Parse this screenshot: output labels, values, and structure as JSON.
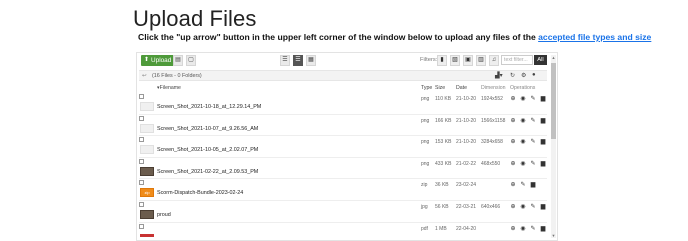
{
  "page": {
    "title": "Upload Files",
    "instructions": "Click the \"up arrow\" button in the upper left corner of the window below to upload any files of the",
    "link_text": "accepted file types and size"
  },
  "toolbar": {
    "upload_label": "Upload",
    "filters_label": "Filters:",
    "text_filter_placeholder": "text filter...",
    "all_label": "All"
  },
  "path": {
    "summary": "(16 Files - 0 Folders)"
  },
  "columns": {
    "filename": "▾Filename",
    "type": "Type",
    "size": "Size",
    "date": "Date",
    "dimension": "Dimension",
    "operations": "Operations"
  },
  "files": [
    {
      "name": "Screen_Shot_2021-10-18_at_12.29.14_PM",
      "type": "png",
      "size": "110 KB",
      "date": "21-10-20",
      "dimension": "1924x552",
      "thumb": "screenshot"
    },
    {
      "name": "Screen_Shot_2021-10-07_at_9.26.56_AM",
      "type": "png",
      "size": "166 KB",
      "date": "21-10-20",
      "dimension": "1566x1158",
      "thumb": "screenshot"
    },
    {
      "name": "Screen_Shot_2021-10-05_at_2.02.07_PM",
      "type": "png",
      "size": "153 KB",
      "date": "21-10-20",
      "dimension": "3284x658",
      "thumb": "screenshot"
    },
    {
      "name": "Screen_Shot_2021-02-22_at_2.09.53_PM",
      "type": "png",
      "size": "433 KB",
      "date": "21-02-22",
      "dimension": "468x550",
      "thumb": "photo"
    },
    {
      "name": "Scorm-Dispatch-Bundle-2023-02-24",
      "type": "zip",
      "size": "36 KB",
      "date": "23-02-24",
      "dimension": "",
      "thumb": "zip"
    },
    {
      "name": "proud",
      "type": "jpg",
      "size": "56 KB",
      "date": "22-03-21",
      "dimension": "640x466",
      "thumb": "photo"
    },
    {
      "name": "",
      "type": "pdf",
      "size": "1 MB",
      "date": "22-04-20",
      "dimension": "",
      "thumb": "pdf"
    }
  ],
  "colors": {
    "upload_button": "#4e9a3a",
    "link": "#1a73e8",
    "zip_thumb": "#f08c1a",
    "all_button": "#333333"
  }
}
